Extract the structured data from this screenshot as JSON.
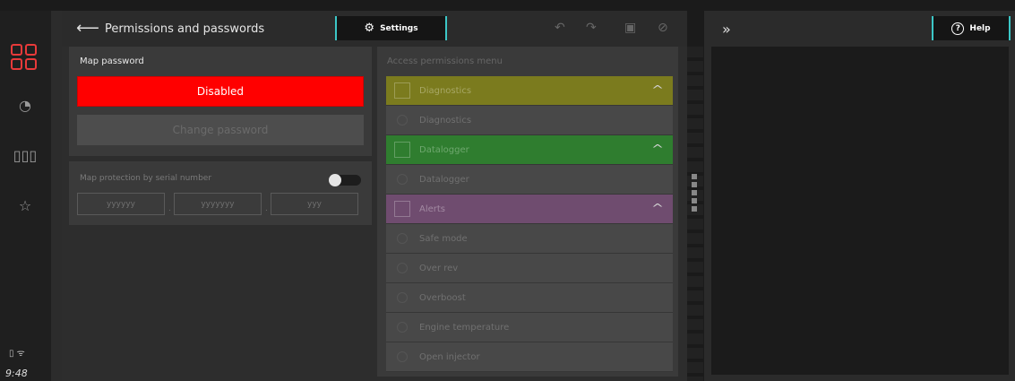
{
  "status": {
    "time": "9:48",
    "icons": "battery wifi"
  },
  "header": {
    "title": "Permissions and passwords",
    "settings_label": "Settings"
  },
  "password": {
    "label": "Map password",
    "state_button": "Disabled",
    "change_button": "Change password"
  },
  "serial": {
    "label": "Map protection by serial number",
    "field1": "yyyyyy",
    "field2": "yyyyyyy",
    "field3": "yyy",
    "sep": "."
  },
  "access": {
    "label": "Access permissions menu",
    "groups": [
      {
        "name": "Diagnostics",
        "color": "#7b7b1e",
        "items": [
          "Diagnostics"
        ]
      },
      {
        "name": "Datalogger",
        "color": "#2f7d2f",
        "items": [
          "Datalogger"
        ]
      },
      {
        "name": "Alerts",
        "color": "#6f4c6f",
        "items": [
          "Safe mode",
          "Over rev",
          "Overboost",
          "Engine temperature",
          "Open injector"
        ]
      }
    ]
  },
  "help": {
    "label": "Help"
  },
  "colors": {
    "accent": "#3cc7c7",
    "danger": "#ff0000",
    "logo": "#e83a3a"
  }
}
